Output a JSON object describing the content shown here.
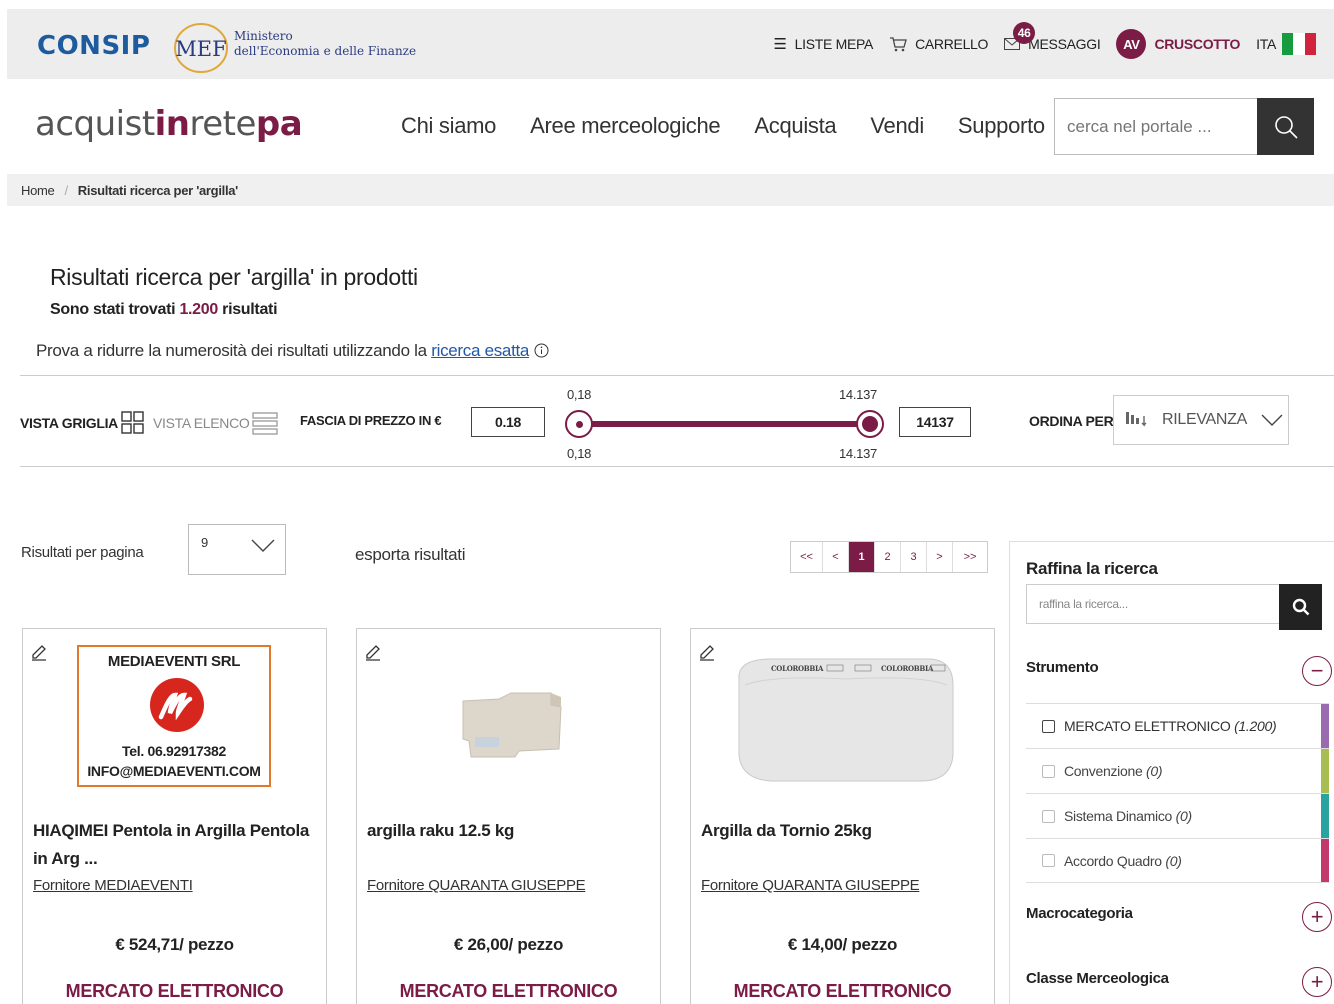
{
  "topbar": {
    "consip_logo": "CONSIP",
    "mef_logo_text": "MEF",
    "mef_line1": "Ministero",
    "mef_line2": "dell'Economia e delle Finanze",
    "liste_mepa": "LISTE MEPA",
    "carrello": "CARRELLO",
    "messaggi": "MESSAGGI",
    "messaggi_count": "46",
    "avatar_initials": "AV",
    "cruscotto": "CRUSCOTTO",
    "lang": "ITA",
    "flag_colors": [
      "#169b3e",
      "#ffffff",
      "#d2233c"
    ]
  },
  "header": {
    "logo_part1": "acquist",
    "logo_part2": "in",
    "logo_part3": "rete",
    "logo_part4": "pa",
    "nav": [
      "Chi siamo",
      "Aree merceologiche",
      "Acquista",
      "Vendi",
      "Supporto"
    ],
    "search_placeholder": "cerca nel portale ..."
  },
  "breadcrumb": {
    "home": "Home",
    "current": "Risultati ricerca per 'argilla'"
  },
  "results": {
    "title": "Risultati ricerca per 'argilla' in prodotti",
    "found_prefix": "Sono stati trovati",
    "found_count": "1.200",
    "found_suffix": "risultati",
    "hint_text": "Prova a ridurre la numerosità dei risultati utilizzando la",
    "hint_link": "ricerca esatta"
  },
  "filters": {
    "vista_griglia": "VISTA GRIGLIA",
    "vista_elenco": "VISTA ELENCO",
    "fascia_label": "FASCIA DI PREZZO IN €",
    "min_value": "0.18",
    "max_value": "14137",
    "slider_min_top": "0,18",
    "slider_min_bottom": "0,18",
    "slider_max_top": "14.137",
    "slider_max_bottom": "14.137",
    "ordina_label": "ORDINA PER",
    "ordina_value": "RILEVANZA"
  },
  "controls": {
    "rpp_label": "Risultati per pagina",
    "rpp_value": "9",
    "export": "esporta risultati",
    "pager": [
      "<<",
      "<",
      "1",
      "2",
      "3",
      ">",
      ">>"
    ],
    "active_page": "1"
  },
  "products": [
    {
      "name_line1": "HIAQIMEI Pentola in Argilla Pentola",
      "name_line2": "in Arg ...",
      "supplier": "Fornitore MEDIAEVENTI",
      "price": "€ 524,71/ pezzo",
      "strumento": "MERCATO ELETTRONICO",
      "image_title": "MEDIAEVENTI SRL",
      "image_tel": "Tel. 06.92917382",
      "image_email": "INFO@MEDIAEVENTI.COM"
    },
    {
      "name_line1": "argilla raku 12.5 kg",
      "name_line2": "",
      "supplier": "Fornitore QUARANTA GIUSEPPE",
      "price": "€ 26,00/ pezzo",
      "strumento": "MERCATO ELETTRONICO"
    },
    {
      "name_line1": "Argilla da Tornio 25kg",
      "name_line2": "",
      "supplier": "Fornitore QUARANTA GIUSEPPE",
      "price": "€ 14,00/ pezzo",
      "strumento": "MERCATO ELETTRONICO",
      "image_brand": "COLOROBBIA"
    }
  ],
  "refine": {
    "title": "Raffina la ricerca",
    "placeholder": "raffina la ricerca...",
    "strumento_title": "Strumento",
    "items": [
      {
        "label": "MERCATO ELETTRONICO",
        "count": "(1.200)",
        "color": "#9b6bb0"
      },
      {
        "label": "Convenzione",
        "count": "(0)",
        "color": "#a9bd52"
      },
      {
        "label": "Sistema Dinamico",
        "count": "(0)",
        "color": "#2aa3a0"
      },
      {
        "label": "Accordo Quadro",
        "count": "(0)",
        "color": "#c23a6b"
      }
    ],
    "macrocategoria": "Macrocategoria",
    "classe": "Classe Merceologica"
  },
  "colors": {
    "accent": "#7a1c46",
    "consip_blue": "#1e5a9e",
    "link_blue": "#2357a6"
  }
}
